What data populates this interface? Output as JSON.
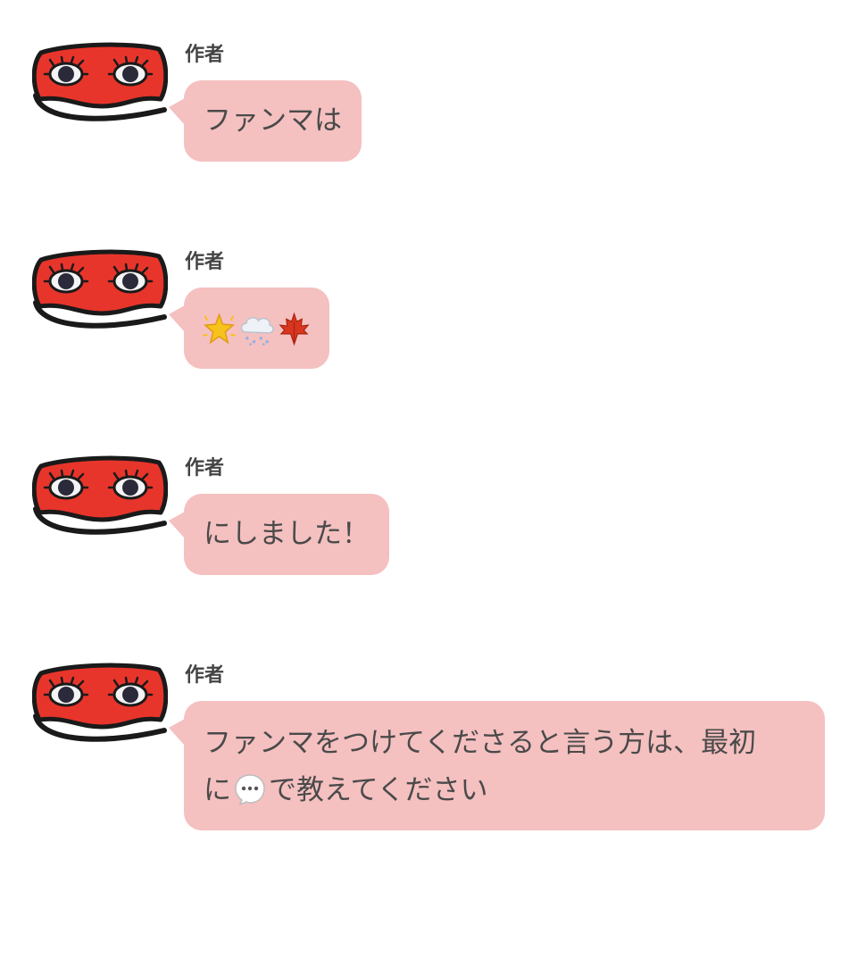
{
  "messages": [
    {
      "author": "作者",
      "text": "ファンマは"
    },
    {
      "author": "作者",
      "emojis": [
        "sparkle-star-icon",
        "snow-cloud-icon",
        "maple-leaf-icon"
      ]
    },
    {
      "author": "作者",
      "text": "にしました！"
    },
    {
      "author": "作者",
      "text_line1": "ファンマをつけてくださると言う方は、最初",
      "text_line2_before": "に",
      "inline_icon": "speech-bubble-icon",
      "text_line2_after": "で教えてください"
    }
  ],
  "colors": {
    "bubble": "#f5c0c0",
    "mask_red": "#e8352b",
    "mask_outline": "#1a1a1a",
    "text": "#4a4a4a"
  }
}
